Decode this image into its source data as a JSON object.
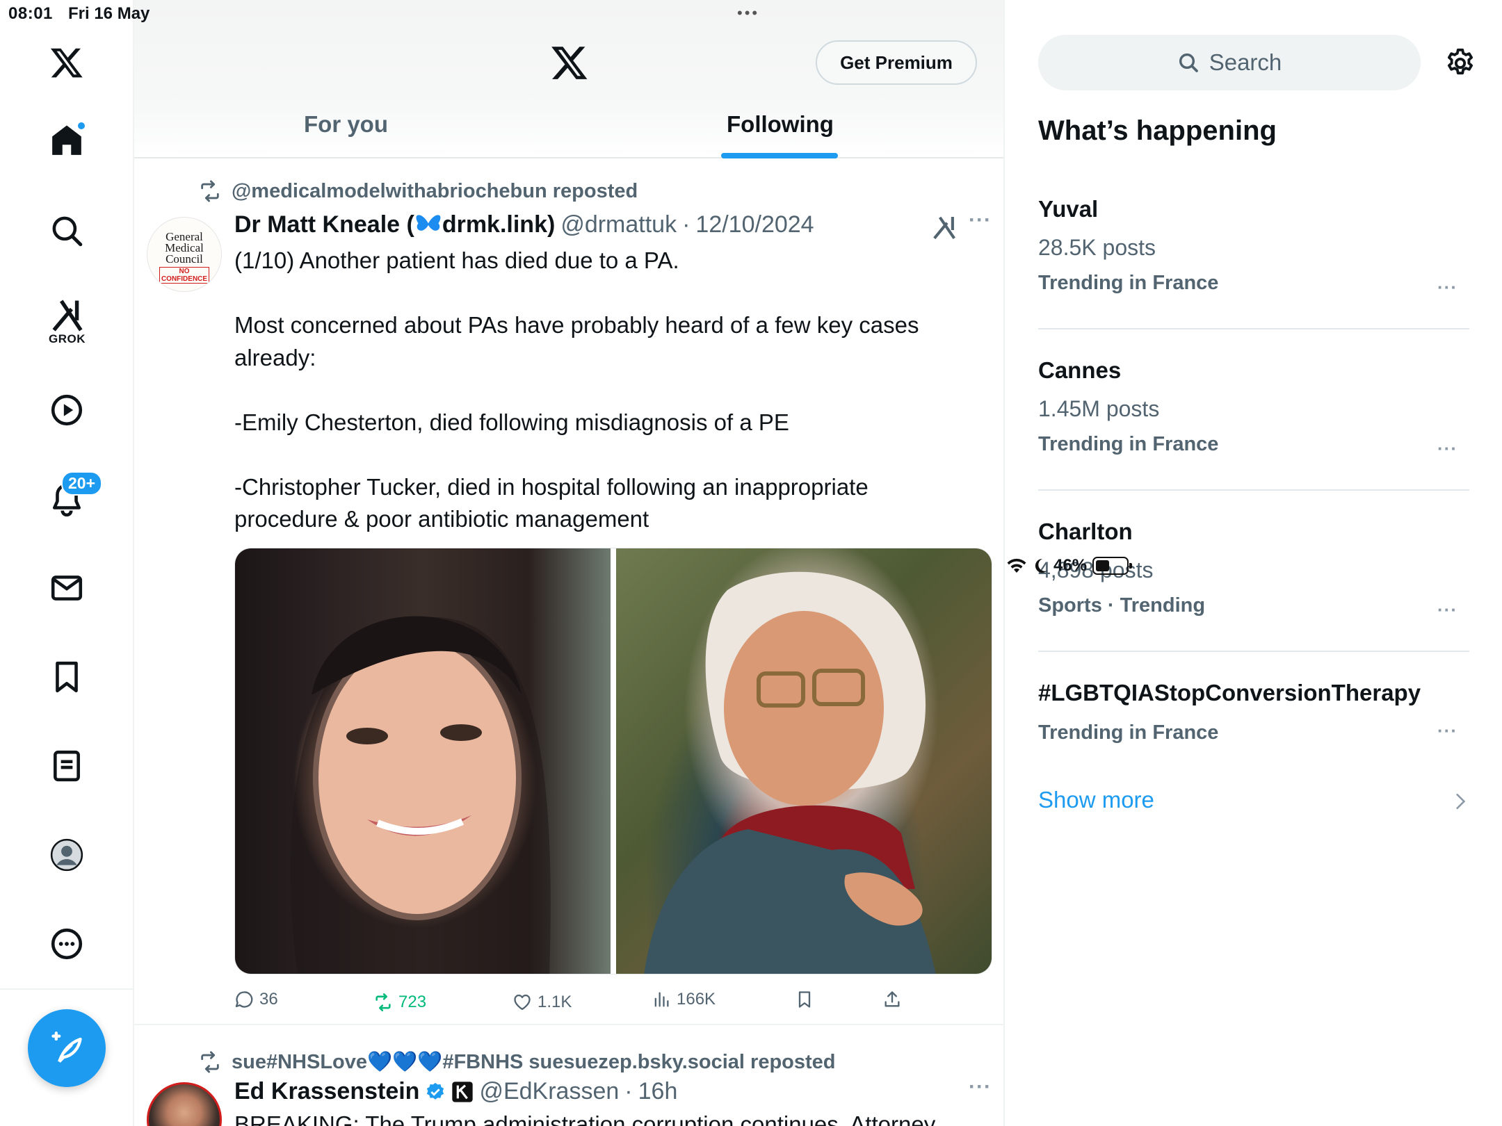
{
  "status_bar": {
    "time": "08:01",
    "date": "Fri 16 May",
    "battery": "46%",
    "battery_fraction": 0.46
  },
  "nav": {
    "notifications_badge": "20+",
    "grok_label": "GROK"
  },
  "header": {
    "premium_label": "Get Premium",
    "tabs": [
      {
        "label": "For you"
      },
      {
        "label": "Following"
      }
    ],
    "active_tab": "Following"
  },
  "post1": {
    "reposted_by": "@medicalmodelwithabriochebun reposted",
    "avatar_text": [
      "General",
      "Medical",
      "Council"
    ],
    "avatar_stamp": "NO CONFIDENCE",
    "author_name": "Dr Matt Kneale (",
    "author_name_link": "drmk.link)",
    "handle": "@drmattuk",
    "date": "12/10/2024",
    "text": "(1/10) Another patient has died due to a PA.\n\nMost concerned about PAs have probably heard of a few key cases already:\n\n-Emily Chesterton, died following misdiagnosis of a PE\n\n-Christopher Tucker, died in hospital following an inappropriate procedure & poor antibiotic management",
    "replies": "36",
    "reposts": "723",
    "likes": "1.1K",
    "views": "166K"
  },
  "post2": {
    "reposted_by": "sue#NHSLove💙💙💙#FBNHS suesuezep.bsky.social reposted",
    "author_name": "Ed Krassenstein",
    "handle": "@EdKrassen",
    "time": "16h",
    "text_partial": "BREAKING: The Trump administration corruption continues. Attorney"
  },
  "sidebar": {
    "search_placeholder": "Search",
    "section_title": "What’s happening",
    "trends": [
      {
        "topic": "Yuval",
        "count": "28.5K posts",
        "context": "Trending in France"
      },
      {
        "topic": "Cannes",
        "count": "1.45M posts",
        "context": "Trending in France"
      },
      {
        "topic": "Charlton",
        "count": "4,898 posts",
        "context": "Sports · Trending"
      },
      {
        "topic": "#LGBTQIAStopConversionTherapy",
        "context": "Trending in France"
      }
    ],
    "show_more": "Show more"
  },
  "colors": {
    "accent": "#1d9bf0",
    "repost_green": "#00ba7c",
    "secondary_text": "#536471"
  }
}
